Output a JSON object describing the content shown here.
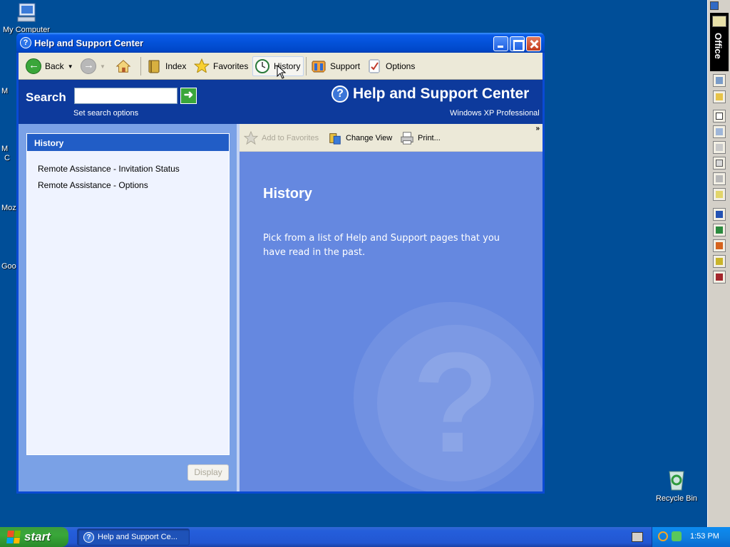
{
  "desktop": {
    "icons": {
      "my_computer": "My Computer",
      "recycle_bin": "Recycle Bin"
    },
    "partial_labels": [
      "M",
      "M",
      "C",
      "Moz",
      "Goo"
    ]
  },
  "window": {
    "title": "Help and Support Center",
    "toolbar": {
      "back": "Back",
      "index": "Index",
      "favorites": "Favorites",
      "history": "History",
      "support": "Support",
      "options": "Options"
    },
    "search": {
      "label": "Search",
      "value": "",
      "set_options": "Set search options"
    },
    "brand": {
      "title": "Help and Support Center",
      "edition": "Windows XP Professional"
    },
    "left_panel": {
      "header": "History",
      "items": [
        "Remote Assistance - Invitation Status",
        "Remote Assistance - Options"
      ],
      "display_button": "Display"
    },
    "content_toolbar": {
      "add_to_favorites": "Add to Favorites",
      "change_view": "Change View",
      "print": "Print..."
    },
    "content": {
      "title": "History",
      "description": "Pick from a list of Help and Support pages that you have read in the past."
    }
  },
  "taskbar": {
    "start": "start",
    "task": "Help and Support Ce...",
    "clock": "1:53 PM"
  },
  "office_bar": {
    "label": "Office"
  },
  "colors": {
    "desktop": "#004e98",
    "title_bar": "#0351d8",
    "search_band": "#0d3a9c",
    "content_blue": "#6588e0",
    "panel_header": "#215dc6"
  }
}
